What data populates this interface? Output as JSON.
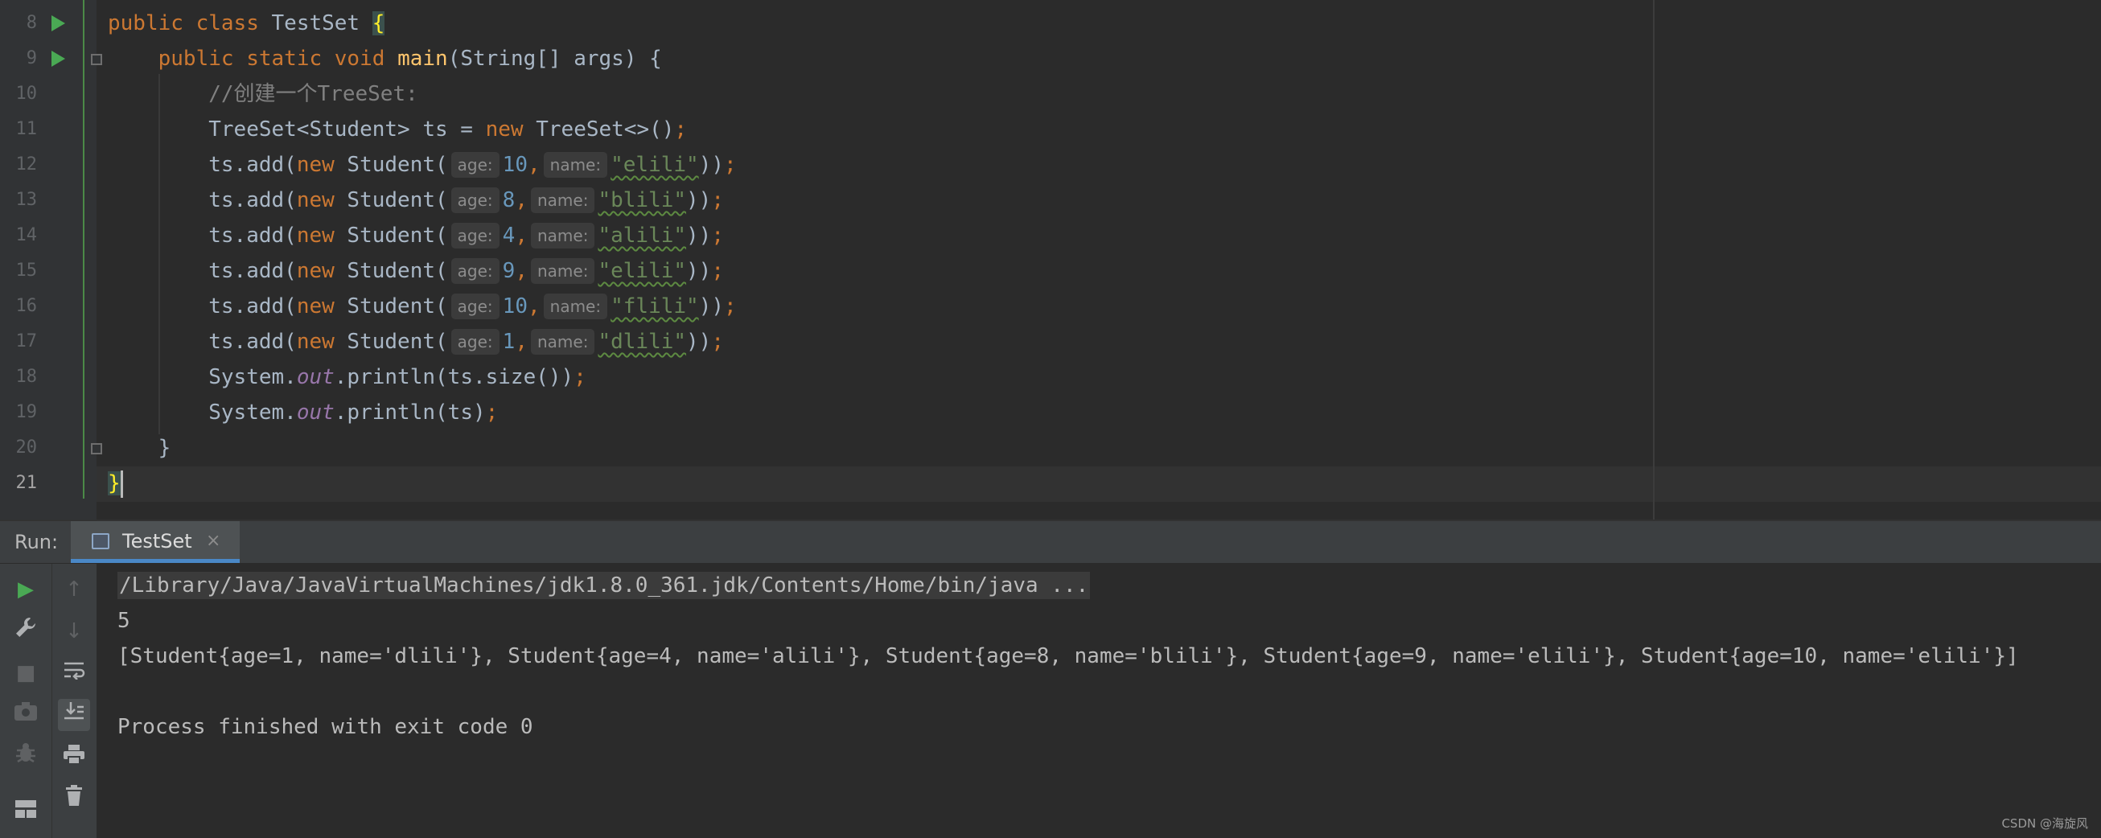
{
  "editor": {
    "line_numbers": [
      "8",
      "9",
      "10",
      "11",
      "12",
      "13",
      "14",
      "15",
      "16",
      "17",
      "18",
      "19",
      "20",
      "21"
    ],
    "current_line": "21",
    "tokens": {
      "kw_public": "public",
      "kw_class": "class",
      "class_name": "TestSet",
      "brace_open": "{",
      "kw_static": "static",
      "kw_void": "void",
      "fn_main": "main",
      "main_params": "(String[] args) {",
      "comment": "//创建一个TreeSet:",
      "treeset_decl": "TreeSet<Student> ts = ",
      "kw_new": "new",
      "treeset_new": " TreeSet<>()",
      "semicolon": ";",
      "add_prefix": "ts.add(",
      "student_ctor": " Student(",
      "hint_age": "age:",
      "hint_name": "name:",
      "comma": ",",
      "close_call": "))",
      "sysout_prefix": "System.",
      "field_out": "out",
      "println_size": ".println(ts.size())",
      "println_ts": ".println(ts)",
      "method_close": "}",
      "class_close": "}"
    },
    "students": [
      {
        "age": "10",
        "name": "\"elili\""
      },
      {
        "age": "8",
        "name": "\"blili\""
      },
      {
        "age": "4",
        "name": "\"alili\""
      },
      {
        "age": "9",
        "name": "\"elili\""
      },
      {
        "age": "10",
        "name": "\"flili\""
      },
      {
        "age": "1",
        "name": "\"dlili\""
      }
    ]
  },
  "run_panel": {
    "title": "Run:",
    "tab_label": "TestSet",
    "tab_close": "×",
    "toolbar_icons": [
      "run-icon",
      "wrench-icon",
      "stop-icon",
      "camera-icon",
      "debug-bug-icon",
      "layout-icon"
    ],
    "toolbar2_icons": [
      "up-arrow-icon",
      "down-arrow-icon",
      "soft-wrap-icon",
      "scroll-to-end-icon",
      "print-icon",
      "trash-icon"
    ],
    "output": [
      "/Library/Java/JavaVirtualMachines/jdk1.8.0_361.jdk/Contents/Home/bin/java ...",
      "5",
      "[Student{age=1, name='dlili'}, Student{age=4, name='alili'}, Student{age=8, name='blili'}, Student{age=9, name='elili'}, Student{age=10, name='elili'}]",
      "",
      "Process finished with exit code 0"
    ]
  },
  "watermark": "CSDN @海旋风",
  "colors": {
    "background": "#2b2b2b",
    "keyword": "#cc7832",
    "function": "#ffc66d",
    "string": "#6a8759",
    "number": "#6897bb",
    "comment": "#808080",
    "field": "#9876aa",
    "run_green": "#4aa954",
    "tab_accent": "#4a88c7"
  }
}
